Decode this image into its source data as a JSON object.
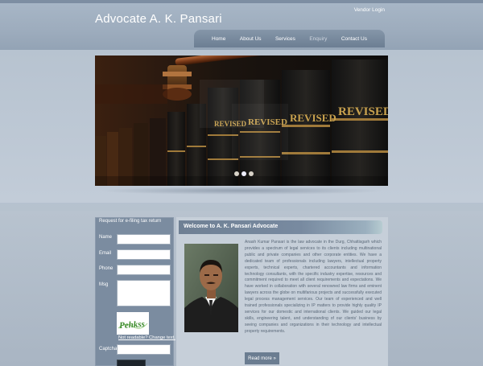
{
  "header": {
    "site_title": "Advocate A. K. Pansari",
    "vendor_login": "Vendor Login"
  },
  "nav": {
    "items": [
      {
        "label": "Home"
      },
      {
        "label": "About Us"
      },
      {
        "label": "Services"
      },
      {
        "label": "Enquiry"
      },
      {
        "label": "Contact Us"
      }
    ]
  },
  "slider": {
    "book_label": "REVISED",
    "dots": 3,
    "active_dot": 1
  },
  "form": {
    "title": "Request for e-filing tax return",
    "name_label": "Name",
    "email_label": "Email",
    "phone_label": "Phone",
    "msg_label": "Msg",
    "captcha_text": "Pehkss",
    "refresh_text": "Not readable? Change text.",
    "captcha_label": "Captcha"
  },
  "content": {
    "header": "Welcome to A. K. Pansari Advocate",
    "description": "Anash Kumar Pansari is the law advocate in the Durg, Chhattisgarh which provides a spectrum of legal services to its clients including multinational public and private companies and other corporate entities. We have a dedicated team of professionals including lawyers, intellectual property experts, technical experts, chartered accountants and information technology consultants, with the specific industry expertise, resources and commitment required to meet all client requirements and expectations. We have worked in collaboration with several renowned law firms and eminent lawyers across the globe on multifarious projects and successfully executed legal process management services. Our team of experienced and well trained professionals specializing in IP matters to provide highly quality IP services for our domestic and international clients. We guided our legal skills, engineering talent, and understanding of our clients' business by seeing companies and organizations in their technology and intellectual property requirements.",
    "read_more": "Read more »"
  },
  "colors": {
    "nav_bg": "#6c7e93",
    "panel_bg": "#7b8ca0",
    "header_bar": "#6f8094"
  }
}
